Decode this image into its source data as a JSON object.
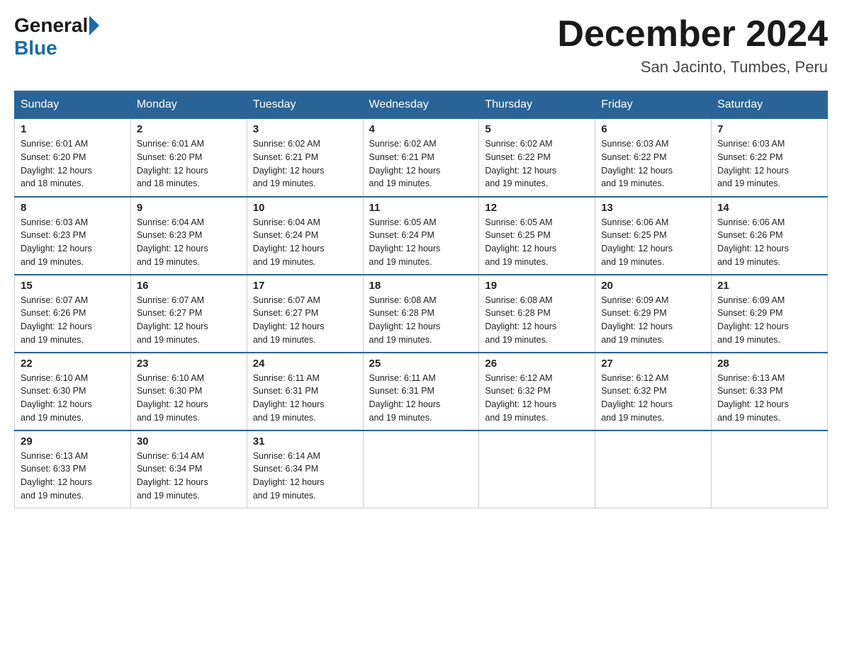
{
  "header": {
    "logo_general": "General",
    "logo_blue": "Blue",
    "month_title": "December 2024",
    "location": "San Jacinto, Tumbes, Peru"
  },
  "days_of_week": [
    "Sunday",
    "Monday",
    "Tuesday",
    "Wednesday",
    "Thursday",
    "Friday",
    "Saturday"
  ],
  "weeks": [
    [
      {
        "day": "1",
        "sunrise": "6:01 AM",
        "sunset": "6:20 PM",
        "daylight": "12 hours and 18 minutes."
      },
      {
        "day": "2",
        "sunrise": "6:01 AM",
        "sunset": "6:20 PM",
        "daylight": "12 hours and 18 minutes."
      },
      {
        "day": "3",
        "sunrise": "6:02 AM",
        "sunset": "6:21 PM",
        "daylight": "12 hours and 19 minutes."
      },
      {
        "day": "4",
        "sunrise": "6:02 AM",
        "sunset": "6:21 PM",
        "daylight": "12 hours and 19 minutes."
      },
      {
        "day": "5",
        "sunrise": "6:02 AM",
        "sunset": "6:22 PM",
        "daylight": "12 hours and 19 minutes."
      },
      {
        "day": "6",
        "sunrise": "6:03 AM",
        "sunset": "6:22 PM",
        "daylight": "12 hours and 19 minutes."
      },
      {
        "day": "7",
        "sunrise": "6:03 AM",
        "sunset": "6:22 PM",
        "daylight": "12 hours and 19 minutes."
      }
    ],
    [
      {
        "day": "8",
        "sunrise": "6:03 AM",
        "sunset": "6:23 PM",
        "daylight": "12 hours and 19 minutes."
      },
      {
        "day": "9",
        "sunrise": "6:04 AM",
        "sunset": "6:23 PM",
        "daylight": "12 hours and 19 minutes."
      },
      {
        "day": "10",
        "sunrise": "6:04 AM",
        "sunset": "6:24 PM",
        "daylight": "12 hours and 19 minutes."
      },
      {
        "day": "11",
        "sunrise": "6:05 AM",
        "sunset": "6:24 PM",
        "daylight": "12 hours and 19 minutes."
      },
      {
        "day": "12",
        "sunrise": "6:05 AM",
        "sunset": "6:25 PM",
        "daylight": "12 hours and 19 minutes."
      },
      {
        "day": "13",
        "sunrise": "6:06 AM",
        "sunset": "6:25 PM",
        "daylight": "12 hours and 19 minutes."
      },
      {
        "day": "14",
        "sunrise": "6:06 AM",
        "sunset": "6:26 PM",
        "daylight": "12 hours and 19 minutes."
      }
    ],
    [
      {
        "day": "15",
        "sunrise": "6:07 AM",
        "sunset": "6:26 PM",
        "daylight": "12 hours and 19 minutes."
      },
      {
        "day": "16",
        "sunrise": "6:07 AM",
        "sunset": "6:27 PM",
        "daylight": "12 hours and 19 minutes."
      },
      {
        "day": "17",
        "sunrise": "6:07 AM",
        "sunset": "6:27 PM",
        "daylight": "12 hours and 19 minutes."
      },
      {
        "day": "18",
        "sunrise": "6:08 AM",
        "sunset": "6:28 PM",
        "daylight": "12 hours and 19 minutes."
      },
      {
        "day": "19",
        "sunrise": "6:08 AM",
        "sunset": "6:28 PM",
        "daylight": "12 hours and 19 minutes."
      },
      {
        "day": "20",
        "sunrise": "6:09 AM",
        "sunset": "6:29 PM",
        "daylight": "12 hours and 19 minutes."
      },
      {
        "day": "21",
        "sunrise": "6:09 AM",
        "sunset": "6:29 PM",
        "daylight": "12 hours and 19 minutes."
      }
    ],
    [
      {
        "day": "22",
        "sunrise": "6:10 AM",
        "sunset": "6:30 PM",
        "daylight": "12 hours and 19 minutes."
      },
      {
        "day": "23",
        "sunrise": "6:10 AM",
        "sunset": "6:30 PM",
        "daylight": "12 hours and 19 minutes."
      },
      {
        "day": "24",
        "sunrise": "6:11 AM",
        "sunset": "6:31 PM",
        "daylight": "12 hours and 19 minutes."
      },
      {
        "day": "25",
        "sunrise": "6:11 AM",
        "sunset": "6:31 PM",
        "daylight": "12 hours and 19 minutes."
      },
      {
        "day": "26",
        "sunrise": "6:12 AM",
        "sunset": "6:32 PM",
        "daylight": "12 hours and 19 minutes."
      },
      {
        "day": "27",
        "sunrise": "6:12 AM",
        "sunset": "6:32 PM",
        "daylight": "12 hours and 19 minutes."
      },
      {
        "day": "28",
        "sunrise": "6:13 AM",
        "sunset": "6:33 PM",
        "daylight": "12 hours and 19 minutes."
      }
    ],
    [
      {
        "day": "29",
        "sunrise": "6:13 AM",
        "sunset": "6:33 PM",
        "daylight": "12 hours and 19 minutes."
      },
      {
        "day": "30",
        "sunrise": "6:14 AM",
        "sunset": "6:34 PM",
        "daylight": "12 hours and 19 minutes."
      },
      {
        "day": "31",
        "sunrise": "6:14 AM",
        "sunset": "6:34 PM",
        "daylight": "12 hours and 19 minutes."
      },
      null,
      null,
      null,
      null
    ]
  ],
  "labels": {
    "sunrise": "Sunrise:",
    "sunset": "Sunset:",
    "daylight": "Daylight:"
  }
}
